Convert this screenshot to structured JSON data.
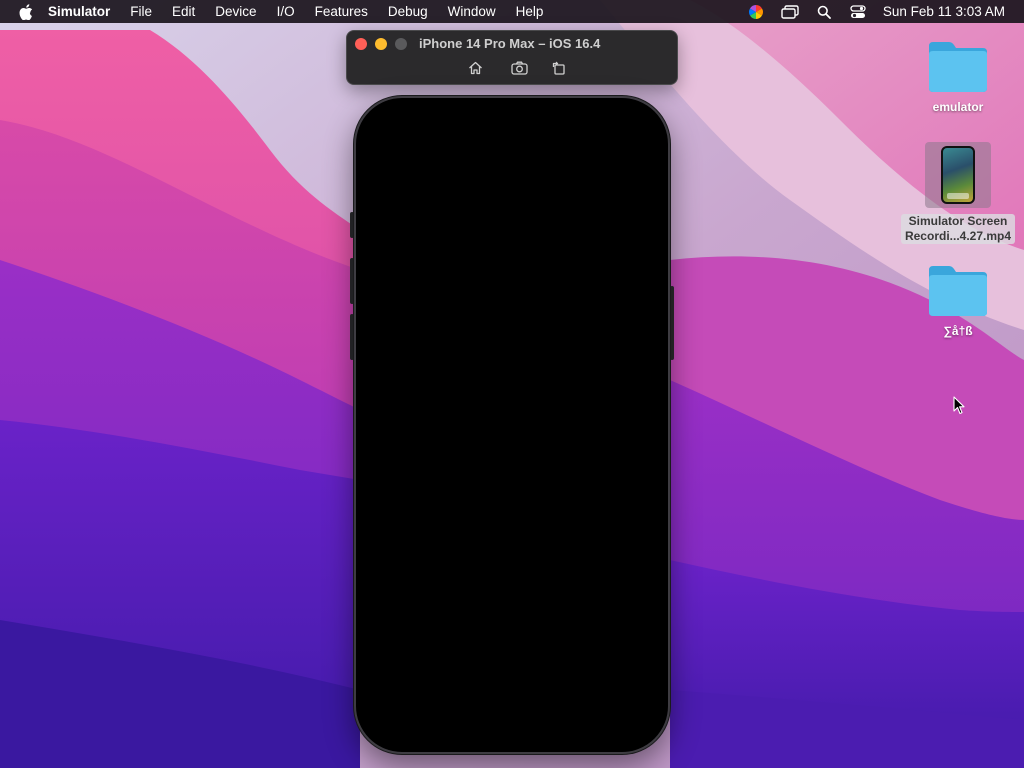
{
  "menubar": {
    "apple_icon": "apple-logo-icon",
    "app_name": "Simulator",
    "menus": [
      "File",
      "Edit",
      "Device",
      "I/O",
      "Features",
      "Debug",
      "Window",
      "Help"
    ],
    "status_icons": [
      "color-wheel-icon",
      "screen-mirroring-icon",
      "search-icon",
      "control-center-icon"
    ],
    "clock": "Sun Feb 11  3:03 AM"
  },
  "simulator": {
    "window_title": "iPhone 14 Pro Max – iOS 16.4",
    "toolbar_buttons": [
      "home-icon",
      "screenshot-icon",
      "rotate-icon"
    ],
    "screen_color": "#000000"
  },
  "desktop": {
    "icons": [
      {
        "label": "emulator",
        "kind": "folder-icon",
        "selected": false
      },
      {
        "label": "Simulator Screen Recordi...4.27.mp4",
        "label_line1": "Simulator Screen",
        "label_line2": "Recordi...4.27.mp4",
        "kind": "video-thumbnail",
        "selected": true
      },
      {
        "label": "∑å†ß",
        "kind": "folder-icon",
        "selected": false
      }
    ]
  },
  "colors": {
    "folder": "#4fb8ea",
    "close": "#ff5f57",
    "minimize": "#febc2e"
  }
}
